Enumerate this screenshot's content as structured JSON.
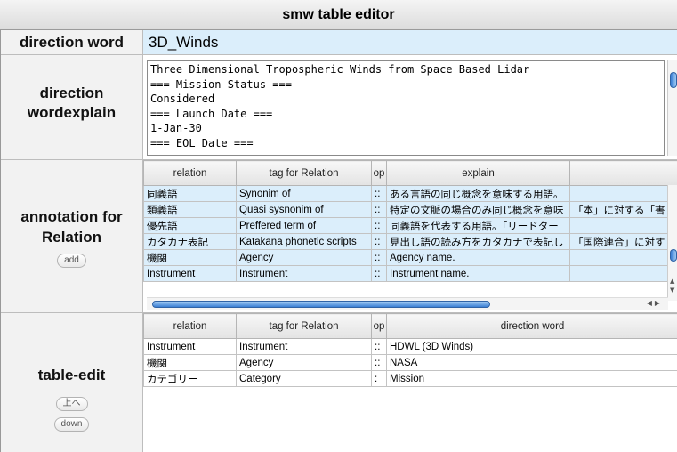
{
  "window": {
    "title": "smw table editor"
  },
  "direction_word": {
    "label": "direction word",
    "value": "3D_Winds"
  },
  "direction_wordexplain": {
    "label_line1": "direction",
    "label_line2": "wordexplain",
    "text": "Three Dimensional Tropospheric Winds from Space Based Lidar\n=== Mission Status ===\nConsidered\n=== Launch Date ===\n1-Jan-30\n=== EOL Date ==="
  },
  "annotation": {
    "label_line1": "annotation for",
    "label_line2": "Relation",
    "add_label": "add",
    "headers": [
      "relation",
      "tag for Relation",
      "op",
      "explain",
      ""
    ],
    "rows": [
      [
        "同義語",
        "Synonim of",
        "::",
        "ある言語の同じ概念を意味する用語。",
        ""
      ],
      [
        "類義語",
        "Quasi sysnonim of",
        "::",
        "特定の文脈の場合のみ同じ概念を意味",
        "「本」に対する「書"
      ],
      [
        "優先語",
        "Preffered term of",
        "::",
        "同義語を代表する用語。「リードター",
        ""
      ],
      [
        "カタカナ表記",
        "Katakana phonetic scripts",
        "::",
        "見出し語の読み方をカタカナで表記し",
        "「国際連合」に対す"
      ],
      [
        "機関",
        "Agency",
        "::",
        "Agency name.",
        ""
      ],
      [
        "Instrument",
        "Instrument",
        "::",
        "Instrument name.",
        ""
      ]
    ]
  },
  "table_edit": {
    "label": "table-edit",
    "up_label": "上へ",
    "down_label": "down",
    "headers": [
      "relation",
      "tag for Relation",
      "op",
      "direction word"
    ],
    "rows": [
      [
        "Instrument",
        "Instrument",
        "::",
        "HDWL (3D Winds)"
      ],
      [
        "機関",
        "Agency",
        "::",
        "NASA"
      ],
      [
        "カテゴリー",
        "Category",
        ":",
        "Mission"
      ]
    ]
  }
}
